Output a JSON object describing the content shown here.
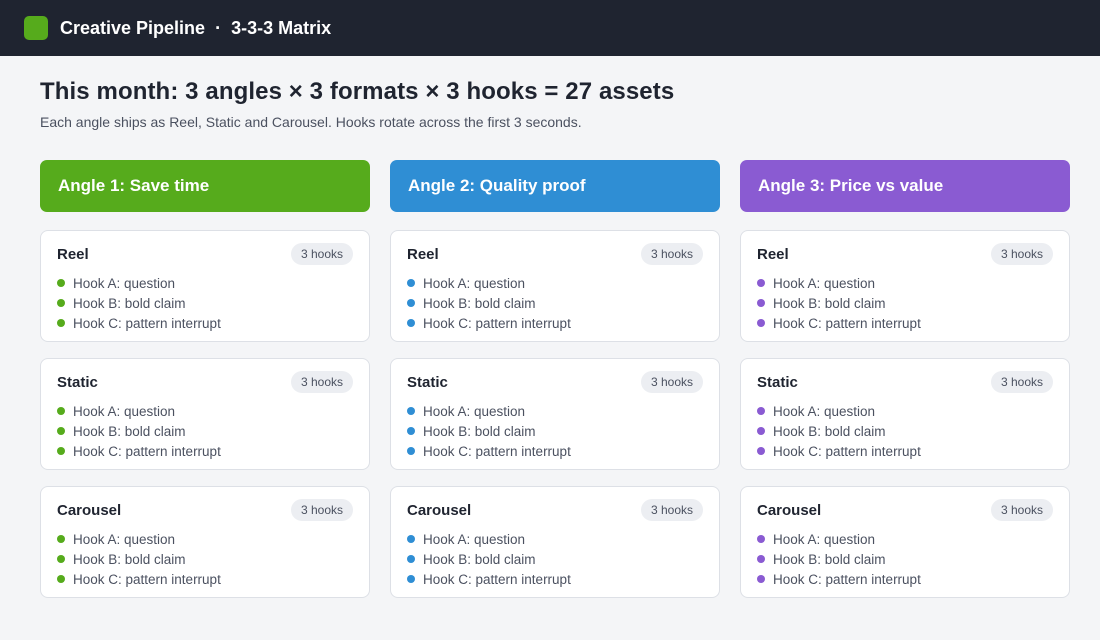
{
  "header": {
    "title": "Creative Pipeline",
    "separator": "·",
    "subtitle": "3-3-3 Matrix",
    "logo_color": "#56ab1c"
  },
  "summary": {
    "headline": "This month: 3 angles × 3 formats × 3 hooks = 27 assets",
    "description": "Each angle ships as Reel, Static and Carousel. Hooks rotate across the first 3 seconds."
  },
  "angles": [
    {
      "label": "Angle 1: Save time",
      "color": "#56ab1c",
      "formats": [
        {
          "name": "Reel",
          "badge": "3 hooks",
          "hooks": [
            "Hook A: question",
            "Hook B: bold claim",
            "Hook C: pattern interrupt"
          ]
        },
        {
          "name": "Static",
          "badge": "3 hooks",
          "hooks": [
            "Hook A: question",
            "Hook B: bold claim",
            "Hook C: pattern interrupt"
          ]
        },
        {
          "name": "Carousel",
          "badge": "3 hooks",
          "hooks": [
            "Hook A: question",
            "Hook B: bold claim",
            "Hook C: pattern interrupt"
          ]
        }
      ]
    },
    {
      "label": "Angle 2: Quality proof",
      "color": "#2f8ed4",
      "formats": [
        {
          "name": "Reel",
          "badge": "3 hooks",
          "hooks": [
            "Hook A: question",
            "Hook B: bold claim",
            "Hook C: pattern interrupt"
          ]
        },
        {
          "name": "Static",
          "badge": "3 hooks",
          "hooks": [
            "Hook A: question",
            "Hook B: bold claim",
            "Hook C: pattern interrupt"
          ]
        },
        {
          "name": "Carousel",
          "badge": "3 hooks",
          "hooks": [
            "Hook A: question",
            "Hook B: bold claim",
            "Hook C: pattern interrupt"
          ]
        }
      ]
    },
    {
      "label": "Angle 3: Price vs value",
      "color": "#8a5bd2",
      "formats": [
        {
          "name": "Reel",
          "badge": "3 hooks",
          "hooks": [
            "Hook A: question",
            "Hook B: bold claim",
            "Hook C: pattern interrupt"
          ]
        },
        {
          "name": "Static",
          "badge": "3 hooks",
          "hooks": [
            "Hook A: question",
            "Hook B: bold claim",
            "Hook C: pattern interrupt"
          ]
        },
        {
          "name": "Carousel",
          "badge": "3 hooks",
          "hooks": [
            "Hook A: question",
            "Hook B: bold claim",
            "Hook C: pattern interrupt"
          ]
        }
      ]
    }
  ]
}
